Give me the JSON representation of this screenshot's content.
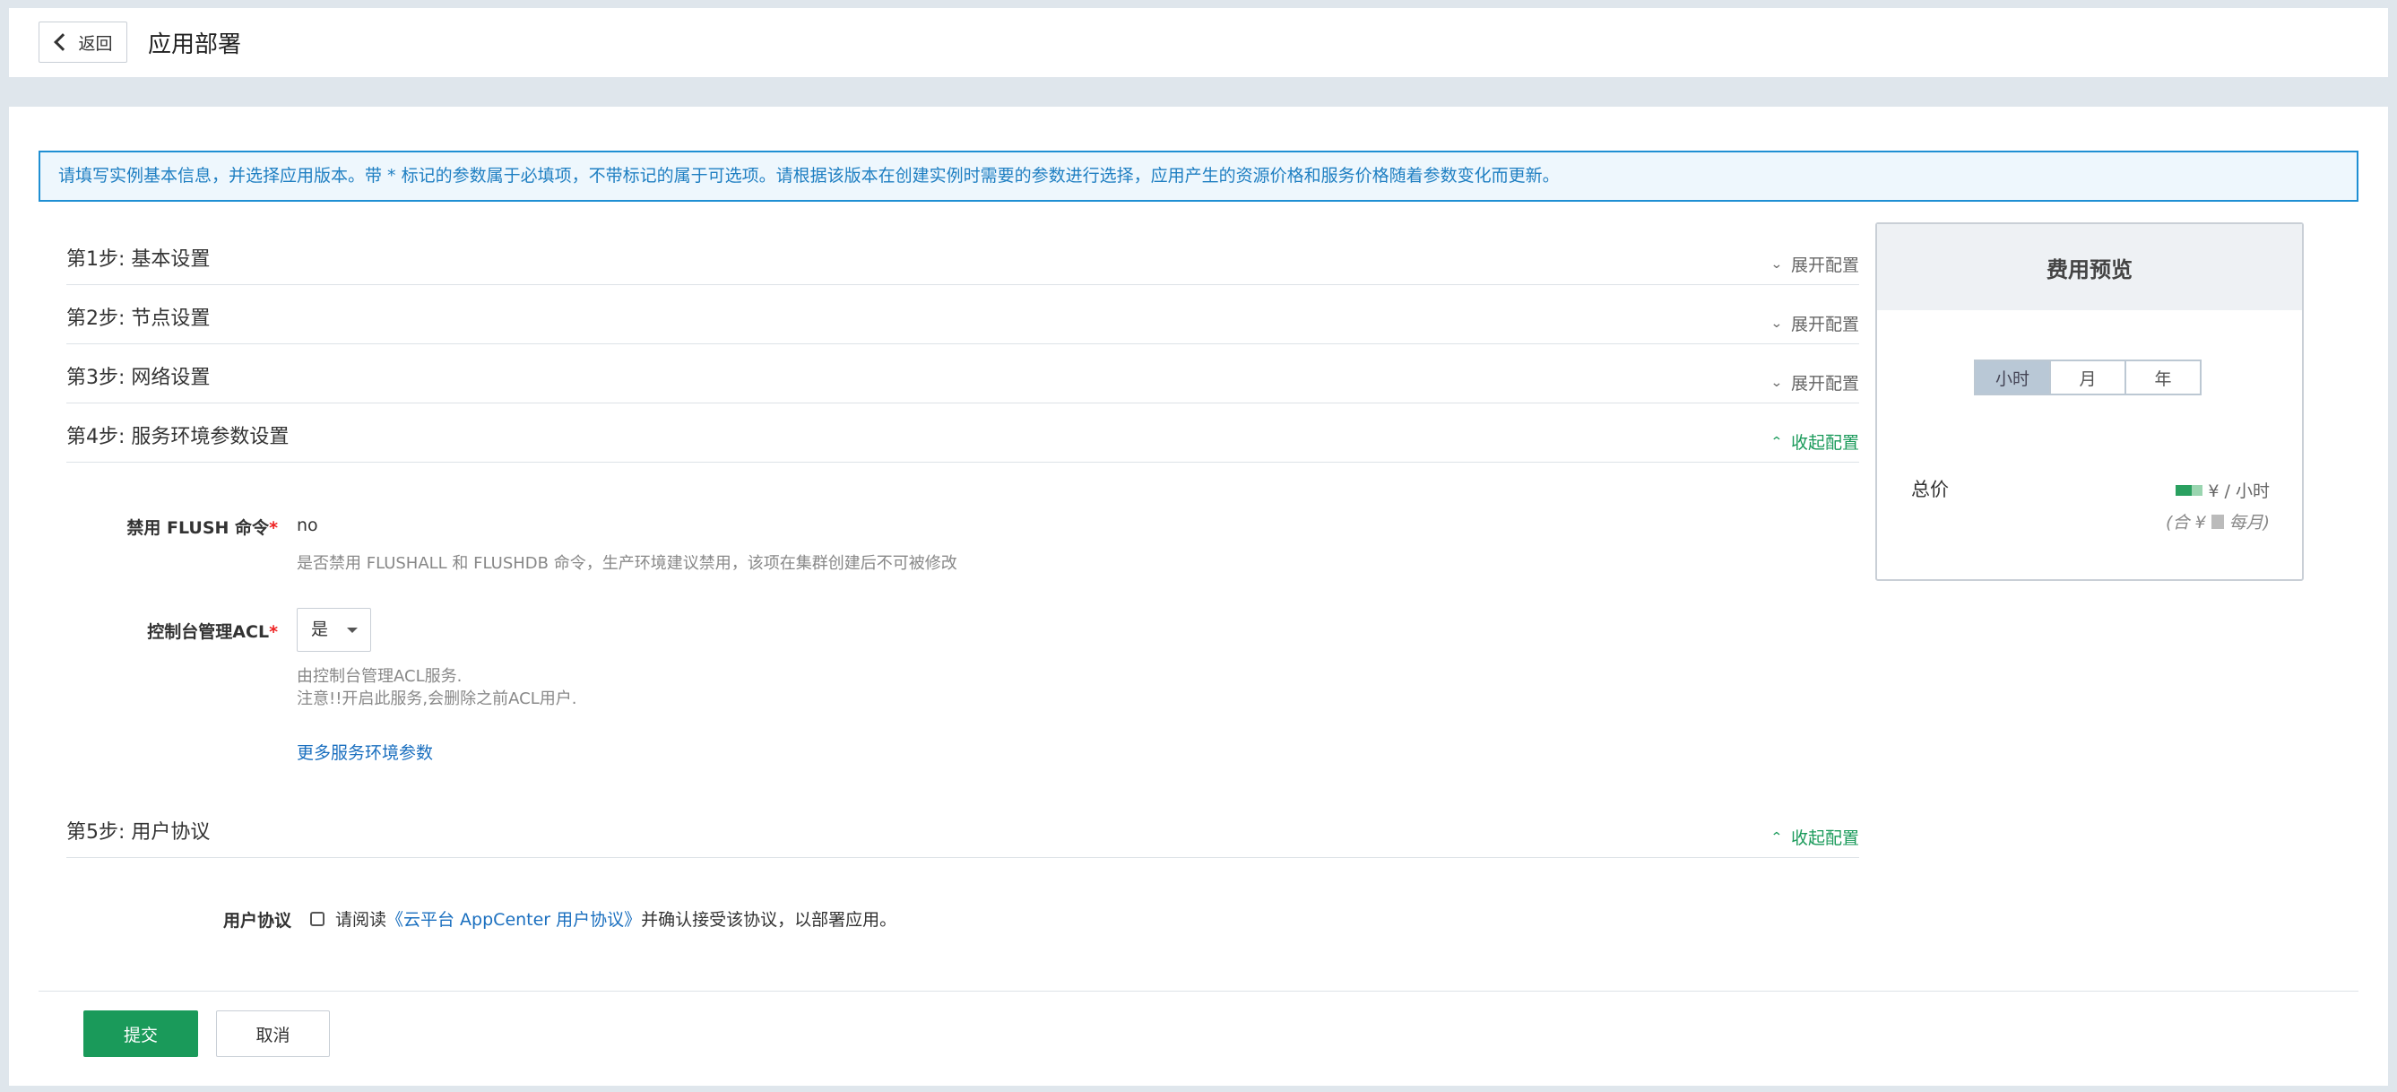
{
  "header": {
    "back_label": "返回",
    "title": "应用部署"
  },
  "notice": "请填写实例基本信息，并选择应用版本。带 * 标记的参数属于必填项，不带标记的属于可选项。请根据该版本在创建实例时需要的参数进行选择，应用产生的资源价格和服务价格随着参数变化而更新。",
  "steps": [
    {
      "title": "第1步: 基本设置",
      "toggle": "展开配置"
    },
    {
      "title": "第2步: 节点设置",
      "toggle": "展开配置"
    },
    {
      "title": "第3步: 网络设置",
      "toggle": "展开配置"
    },
    {
      "title": "第4步: 服务环境参数设置",
      "toggle": "收起配置"
    },
    {
      "title": "第5步: 用户协议",
      "toggle": "收起配置"
    }
  ],
  "service_env": {
    "flush": {
      "label": "禁用 FLUSH 命令",
      "required_mark": "*",
      "value": "no",
      "help": "是否禁用 FLUSHALL 和 FLUSHDB 命令，生产环境建议禁用，该项在集群创建后不可被修改"
    },
    "acl": {
      "label": "控制台管理ACL",
      "required_mark": "*",
      "value": "是",
      "help_line1": "由控制台管理ACL服务.",
      "help_line2": "注意!!开启此服务,会删除之前ACL用户."
    },
    "more_link": "更多服务环境参数"
  },
  "agreement": {
    "label": "用户协议",
    "prefix": "请阅读",
    "link": "《云平台 AppCenter 用户协议》",
    "suffix": "并确认接受该协议，以部署应用。",
    "checked": false
  },
  "actions": {
    "submit": "提交",
    "cancel": "取消"
  },
  "cost": {
    "title": "费用预览",
    "periods": [
      "小时",
      "月",
      "年"
    ],
    "active_period": "小时",
    "total_label": "总价",
    "price_unit": "¥ / 小时",
    "price_sub_prefix": "(合 ¥",
    "price_sub_suffix": "每月)"
  },
  "colors": {
    "accent_green": "#1a9a5a",
    "link_blue": "#1a6fbf",
    "notice_border": "#1f8fd3"
  }
}
